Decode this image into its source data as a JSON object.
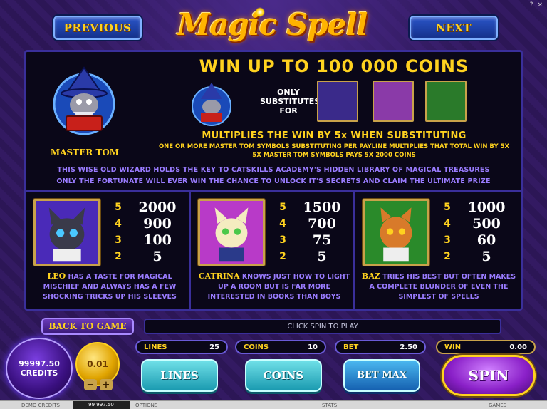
{
  "window": {
    "help_icon": "?",
    "close_icon": "×"
  },
  "nav": {
    "previous_label": "PREVIOUS",
    "next_label": "NEXT"
  },
  "logo": {
    "text": "Magic Spell"
  },
  "paytable": {
    "headline": "WIN UP TO 100 000 COINS",
    "wild_name": "MASTER TOM",
    "substitutes_label": "ONLY SUBSTITUTES FOR",
    "multiplier_text": "MULTIPLIES THE WIN BY 5x WHEN SUBSTITUTING",
    "detail_line_1": "ONE OR MORE MASTER TOM SYMBOLS SUBSTITUTING PER PAYLINE MULTIPLIES THAT TOTAL WIN BY 5X",
    "detail_line_2": "5X MASTER TOM SYMBOLS PAYS 5X 2000 COINS",
    "lore_line_1": "THIS WISE OLD WIZARD HOLDS THE KEY TO CATSKILLS ACADEMY'S HIDDEN LIBRARY OF MAGICAL TREASURES",
    "lore_line_2": "ONLY THE FORTUNATE WILL EVER WIN THE CHANCE TO UNLOCK IT'S SECRETS AND CLAIM THE ULTIMATE PRIZE",
    "symbols": [
      {
        "name": "LEO",
        "description": " HAS A TASTE FOR MAGICAL MISCHIEF AND ALWAYS HAS A FEW SHOCKING TRICKS UP HIS SLEEVES",
        "pays": [
          {
            "count": "5",
            "value": "2000"
          },
          {
            "count": "4",
            "value": "900"
          },
          {
            "count": "3",
            "value": "100"
          },
          {
            "count": "2",
            "value": "5"
          }
        ]
      },
      {
        "name": "CATRINA",
        "description": " KNOWS JUST HOW TO LIGHT UP A ROOM BUT IS FAR MORE INTERESTED IN BOOKS THAN BOYS",
        "pays": [
          {
            "count": "5",
            "value": "1500"
          },
          {
            "count": "4",
            "value": "700"
          },
          {
            "count": "3",
            "value": "75"
          },
          {
            "count": "2",
            "value": "5"
          }
        ]
      },
      {
        "name": "BAZ",
        "description": " TRIES HIS BEST BUT OFTEN MAKES A COMPLETE BLUNDER OF EVEN THE SIMPLEST OF SPELLS",
        "pays": [
          {
            "count": "5",
            "value": "1000"
          },
          {
            "count": "4",
            "value": "500"
          },
          {
            "count": "3",
            "value": "60"
          },
          {
            "count": "2",
            "value": "5"
          }
        ]
      }
    ]
  },
  "controls": {
    "back_label": "BACK TO GAME",
    "message": "CLICK SPIN TO PLAY",
    "credits_value": "99997.50",
    "credits_label": "CREDITS",
    "coin_value": "0.01",
    "coin_minus": "−",
    "coin_plus": "+",
    "lines_label": "LINES",
    "lines_value": "25",
    "coins_label": "COINS",
    "coins_value": "10",
    "bet_label": "BET",
    "bet_value": "2.50",
    "win_label": "WIN",
    "win_value": "0.00",
    "lines_button": "LINES",
    "coins_button": "COINS",
    "betmax_button": "BET MAX",
    "spin_button": "SPIN"
  },
  "footer": {
    "demo_label": "DEMO CREDITS",
    "credits": "99 997.50",
    "options": "OPTIONS",
    "stats": "STATS",
    "games": "GAMES"
  },
  "colors": {
    "accent": "#ffd21f",
    "lore": "#9a7cff",
    "frame": "#3a2f9a"
  }
}
